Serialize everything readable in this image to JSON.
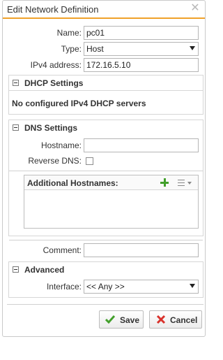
{
  "dialog": {
    "title": "Edit Network Definition",
    "close_icon": "close-icon"
  },
  "form": {
    "name": {
      "label": "Name:",
      "value": "pc01"
    },
    "type": {
      "label": "Type:",
      "value": "Host"
    },
    "ipv4": {
      "label": "IPv4 address:",
      "value": "172.16.5.10"
    }
  },
  "dhcp": {
    "title": "DHCP Settings",
    "message": "No configured IPv4 DHCP servers"
  },
  "dns": {
    "title": "DNS Settings",
    "hostname": {
      "label": "Hostname:",
      "value": ""
    },
    "reverse_dns": {
      "label": "Reverse DNS:",
      "checked": false
    },
    "additional_hostnames": {
      "title": "Additional Hostnames:",
      "items": []
    }
  },
  "comment": {
    "label": "Comment:",
    "value": ""
  },
  "advanced": {
    "title": "Advanced",
    "interface": {
      "label": "Interface:",
      "value": "<< Any >>"
    }
  },
  "buttons": {
    "save": "Save",
    "cancel": "Cancel"
  },
  "colors": {
    "accent": "#f0a12a",
    "save_check": "#43a02c",
    "cancel_x": "#d9312b"
  }
}
